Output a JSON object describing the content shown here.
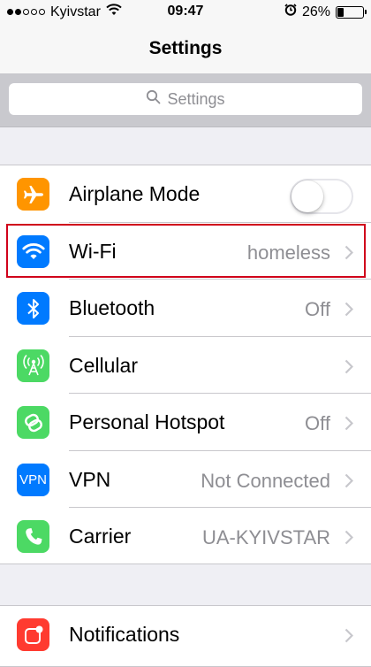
{
  "status_bar": {
    "carrier": "Kyivstar",
    "time": "09:47",
    "battery_percent": "26%",
    "signal_bars_filled": 2,
    "signal_bars_total": 5,
    "battery_level": 0.26
  },
  "nav": {
    "title": "Settings"
  },
  "search": {
    "placeholder": "Settings"
  },
  "rows": [
    {
      "label": "Airplane Mode",
      "toggle_on": false,
      "icon": "airplane-icon",
      "color": "#ff9500"
    },
    {
      "label": "Wi-Fi",
      "value": "homeless",
      "icon": "wifi-icon",
      "color": "#007aff",
      "highlighted": true
    },
    {
      "label": "Bluetooth",
      "value": "Off",
      "icon": "bluetooth-icon",
      "color": "#007aff"
    },
    {
      "label": "Cellular",
      "value": "",
      "icon": "cellular-antenna-icon",
      "color": "#4cd964"
    },
    {
      "label": "Personal Hotspot",
      "value": "Off",
      "icon": "hotspot-icon",
      "color": "#4cd964"
    },
    {
      "label": "VPN",
      "value": "Not Connected",
      "icon": "vpn-icon",
      "icon_text": "VPN",
      "color": "#007aff"
    },
    {
      "label": "Carrier",
      "value": "UA-KYIVSTAR",
      "icon": "phone-icon",
      "color": "#4cd964"
    },
    {
      "label": "Notifications",
      "value": "",
      "icon": "notifications-icon",
      "color": "#ff3b30"
    }
  ],
  "colors": {
    "highlight_border": "#d0021b"
  }
}
